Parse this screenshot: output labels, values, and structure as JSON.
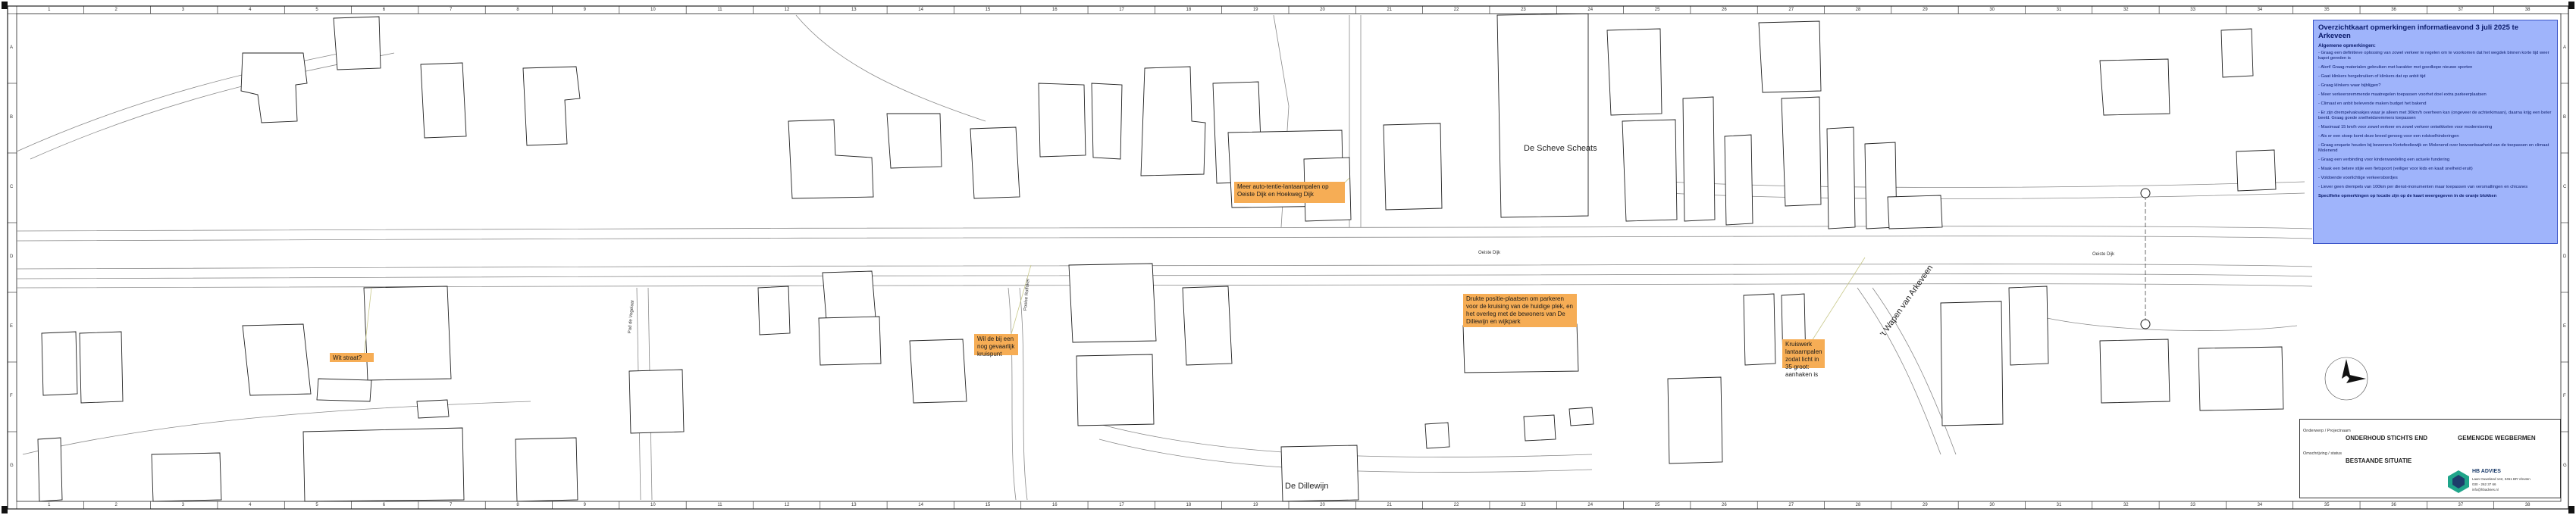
{
  "map": {
    "streets": [
      {
        "name": "De Scheve Scheats",
        "kind": "main"
      },
      {
        "name": "De Dillewijn",
        "kind": "main"
      },
      {
        "name": "'t Wapen van Arkeveen",
        "kind": "main"
      },
      {
        "name": "Oeiste Dijk",
        "kind": "small"
      },
      {
        "name": "Oeiste Dijk",
        "kind": "small"
      },
      {
        "name": "Pad de Vogelaar",
        "kind": "small"
      },
      {
        "name": "Poolse Roffoker",
        "kind": "small"
      }
    ],
    "notes": [
      "Meer auto-tentie-lantaarnpalen op Oeiste Dijk en Hoekweg Dijk",
      "Drukte positie-plaatsen om parkeren voor de kruising van de huidige plek, en het overleg met de bewoners van De Dillewijn en wijkpark",
      "Kruiswerk lantaarnpalen zodat licht in 35 groot: aanhaken is",
      "Wil de bij een nog gevaarlijk kruispunt",
      "Wit straat?"
    ],
    "colors": {
      "note": "#f6ad55",
      "summary_bg": "#9fb4fb",
      "line": "#333333",
      "road": "#888888"
    }
  },
  "summary": {
    "title": "Overzichtkaart opmerkingen informatieavond 3 juli 2025 te Arkeveen",
    "heading": "Algemene opmerkingen:",
    "items": [
      "- Graag een definitieve oplossing van zowel verkeer te regelen om te voorkomen dat het wegdek binnen korte tijd weer kapot gereden is",
      "- Alert! Graag materialen gebruiken met karakter met goedkope nieuwe sporten",
      "- Gaat klinkers hergebruiken of klinkers dat op anbit tijd",
      "- Graag klinkers waar bijblijgen?",
      "- Meer verkeersremmende maatregelen toepassen voorhet doel extra parkeerplaatsen",
      "- Climaat en anbit belevende maken budget het bakend",
      "- Er zijn drempelvakvakjes waar je alleen met 30km/h overheen kan (ongeveer de achterkimaan), daarna krijg een beter beeld. Graag goede snelheidsremmers toepassen",
      "- Maximaal 15 km/h voor zowel verkeer en zowel verkeer ontwikkelen voor modernisering",
      "- Als er een stoep komt deze breed genoeg voor een rolstoelhinderingen",
      "- Graag enquete houden bij bewoners Kortefeeliewijk en Molenend over bewoonbaarheid van de toepassen en climaat Molenend",
      "- Graag een verbinding voor kinderwandeling een actuele fundering",
      "- Maak een betere stijle een fietspoort (veiliger voor kids en kaalt snelheid eruit)",
      "- Voldoende voorlichtige verkeersbordjes",
      "- Liever geen drempels van 100km per dienst-monumenten maar toepassen van versmallingen en chicanes"
    ],
    "footer": "Specifieke opmerkingen op locatie zijn op de kaart weergegeven in de oranje blokken"
  },
  "titleblock": {
    "project_label": "Onderwerp / Projectnaam",
    "project": "ONDERHOUD STICHTS END",
    "sheet_title": "GEMENGDE WEGBERMEN",
    "status_label": "Omschrijving / status",
    "status": "BESTAANDE SITUATIE",
    "company": "HB ADVIES",
    "company_lines": [
      "Laan Ouweland 142, 3451 BR Vleuten",
      "030 - 262 37 66",
      "info@hbadvies.nl"
    ]
  },
  "grid": {
    "columns": [
      "1",
      "2",
      "3",
      "4",
      "5",
      "6",
      "7",
      "8",
      "9",
      "10",
      "11",
      "12",
      "13",
      "14",
      "15",
      "16",
      "17",
      "18",
      "19",
      "20",
      "21",
      "22",
      "23",
      "24",
      "25",
      "26",
      "27",
      "28",
      "29",
      "30",
      "31",
      "32",
      "33",
      "34",
      "35",
      "36",
      "37",
      "38"
    ],
    "rows": [
      "A",
      "B",
      "C",
      "D",
      "E",
      "F",
      "G"
    ]
  }
}
